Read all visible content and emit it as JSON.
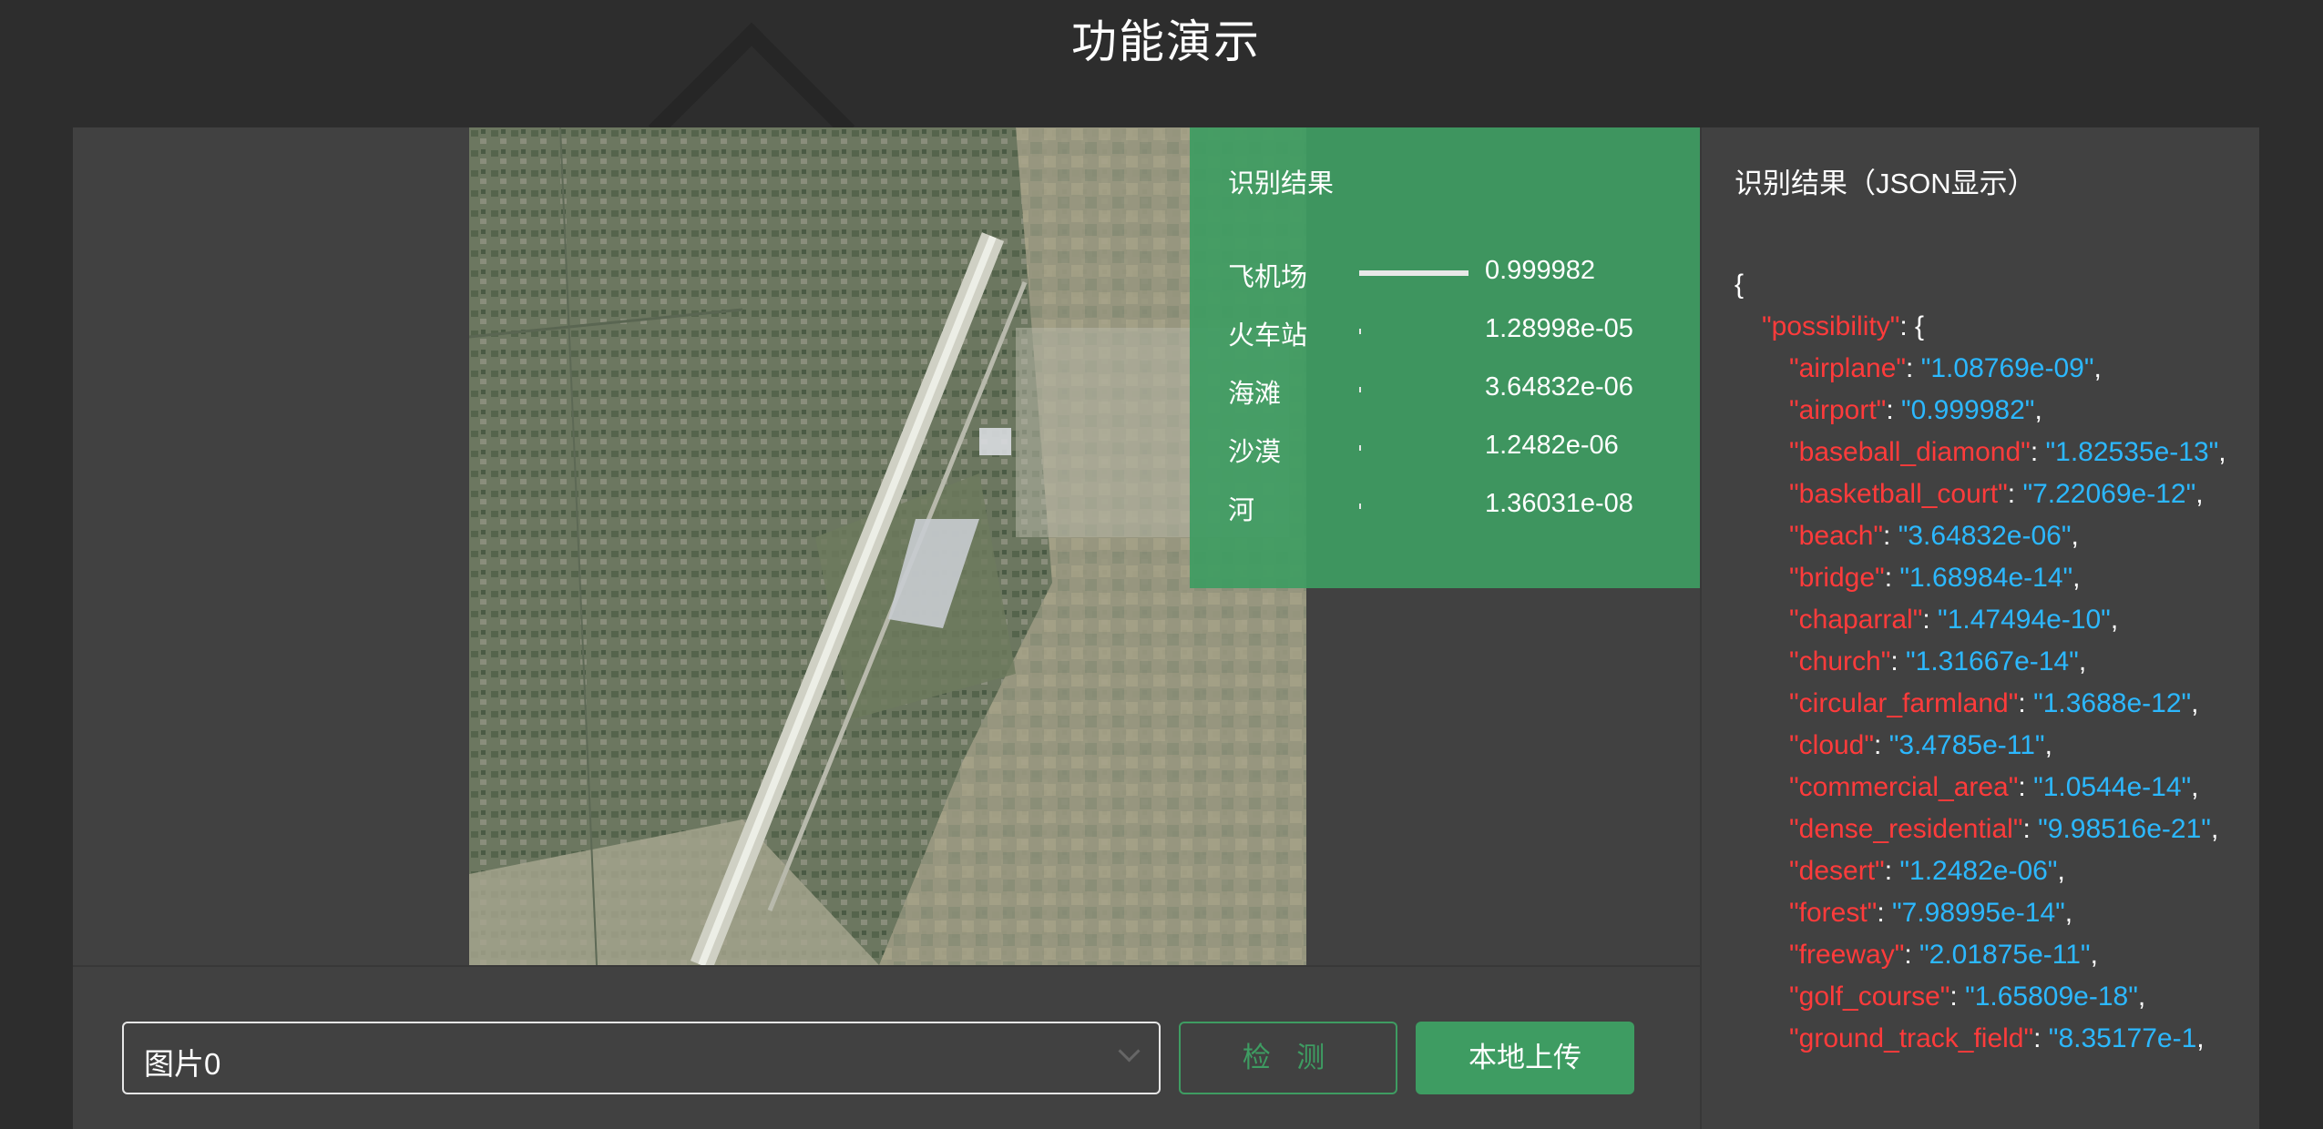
{
  "page": {
    "title": "功能演示"
  },
  "result_panel": {
    "title": "识别结果",
    "rows": [
      {
        "label": "飞机场",
        "value": "0.999982",
        "bar_fraction": 0.999982
      },
      {
        "label": "火车站",
        "value": "1.28998e-05",
        "bar_fraction": 1.28998e-05
      },
      {
        "label": "海滩",
        "value": "3.64832e-06",
        "bar_fraction": 3.64832e-06
      },
      {
        "label": "沙漠",
        "value": "1.2482e-06",
        "bar_fraction": 1.2482e-06
      },
      {
        "label": "河",
        "value": "1.36031e-08",
        "bar_fraction": 1.36031e-08
      }
    ]
  },
  "controls": {
    "select_value": "图片0",
    "detect_label": "检 测",
    "upload_label": "本地上传"
  },
  "json_panel": {
    "title": "识别结果（JSON显示）",
    "open_brace": "{",
    "root_key": "\"possibility\"",
    "root_open": ": {",
    "entries": [
      {
        "key": "\"airplane\"",
        "value": "\"1.08769e-09\""
      },
      {
        "key": "\"airport\"",
        "value": "\"0.999982\""
      },
      {
        "key": "\"baseball_diamond\"",
        "value": "\"1.82535e-13\""
      },
      {
        "key": "\"basketball_court\"",
        "value": "\"7.22069e-12\""
      },
      {
        "key": "\"beach\"",
        "value": "\"3.64832e-06\""
      },
      {
        "key": "\"bridge\"",
        "value": "\"1.68984e-14\""
      },
      {
        "key": "\"chaparral\"",
        "value": "\"1.47494e-10\""
      },
      {
        "key": "\"church\"",
        "value": "\"1.31667e-14\""
      },
      {
        "key": "\"circular_farmland\"",
        "value": "\"1.3688e-12\""
      },
      {
        "key": "\"cloud\"",
        "value": "\"3.4785e-11\""
      },
      {
        "key": "\"commercial_area\"",
        "value": "\"1.0544e-14\""
      },
      {
        "key": "\"dense_residential\"",
        "value": "\"9.98516e-21\""
      },
      {
        "key": "\"desert\"",
        "value": "\"1.2482e-06\""
      },
      {
        "key": "\"forest\"",
        "value": "\"7.98995e-14\""
      },
      {
        "key": "\"freeway\"",
        "value": "\"2.01875e-11\""
      },
      {
        "key": "\"golf_course\"",
        "value": "\"1.65809e-18\""
      },
      {
        "key": "\"ground_track_field\"",
        "value": "\"8.35177e-1"
      }
    ]
  },
  "colors": {
    "accent_green": "#3e9c62",
    "json_key": "#ff3b3b",
    "json_value": "#2cb8ff",
    "panel_bg": "#414141",
    "page_bg": "#2d2d2d"
  }
}
